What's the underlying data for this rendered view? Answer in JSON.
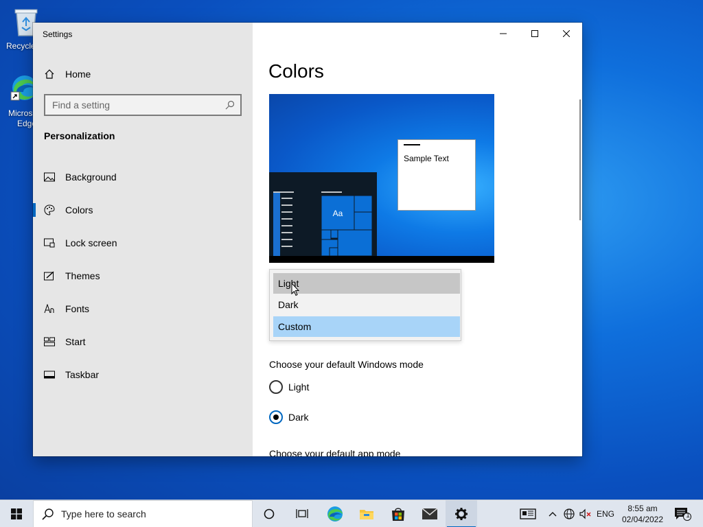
{
  "desktop": {
    "icons": [
      {
        "label": "Recycle",
        "icon": "recycle-bin-icon"
      },
      {
        "label_line1": "Micros",
        "label_line2": "Edge",
        "icon": "edge-icon"
      }
    ]
  },
  "window": {
    "title": "Settings",
    "nav": {
      "home_label": "Home",
      "search_placeholder": "Find a setting",
      "section_title": "Personalization",
      "items": [
        {
          "label": "Background",
          "icon": "picture-icon"
        },
        {
          "label": "Colors",
          "icon": "palette-icon",
          "active": true
        },
        {
          "label": "Lock screen",
          "icon": "lock-screen-icon"
        },
        {
          "label": "Themes",
          "icon": "themes-icon"
        },
        {
          "label": "Fonts",
          "icon": "fonts-icon"
        },
        {
          "label": "Start",
          "icon": "start-icon"
        },
        {
          "label": "Taskbar",
          "icon": "taskbar-icon"
        }
      ]
    },
    "content": {
      "page_title": "Colors",
      "preview": {
        "sample_text": "Sample Text",
        "tile_label": "Aa"
      },
      "color_dropdown": {
        "options": [
          "Light",
          "Dark",
          "Custom"
        ],
        "hovered": "Light",
        "selected": "Custom"
      },
      "windows_mode": {
        "label": "Choose your default Windows mode",
        "options": [
          {
            "label": "Light",
            "checked": false
          },
          {
            "label": "Dark",
            "checked": true
          }
        ]
      },
      "app_mode_label": "Choose your default app mode"
    }
  },
  "taskbar": {
    "search_placeholder": "Type here to search",
    "language": "ENG",
    "time": "8:55 am",
    "date": "02/04/2022",
    "notification_count": "1"
  },
  "colors": {
    "accent": "#0067c0",
    "nav_background": "#e6e6e6",
    "dropdown_selected": "#a8d4f8",
    "dropdown_hover": "#c6c6c6"
  }
}
